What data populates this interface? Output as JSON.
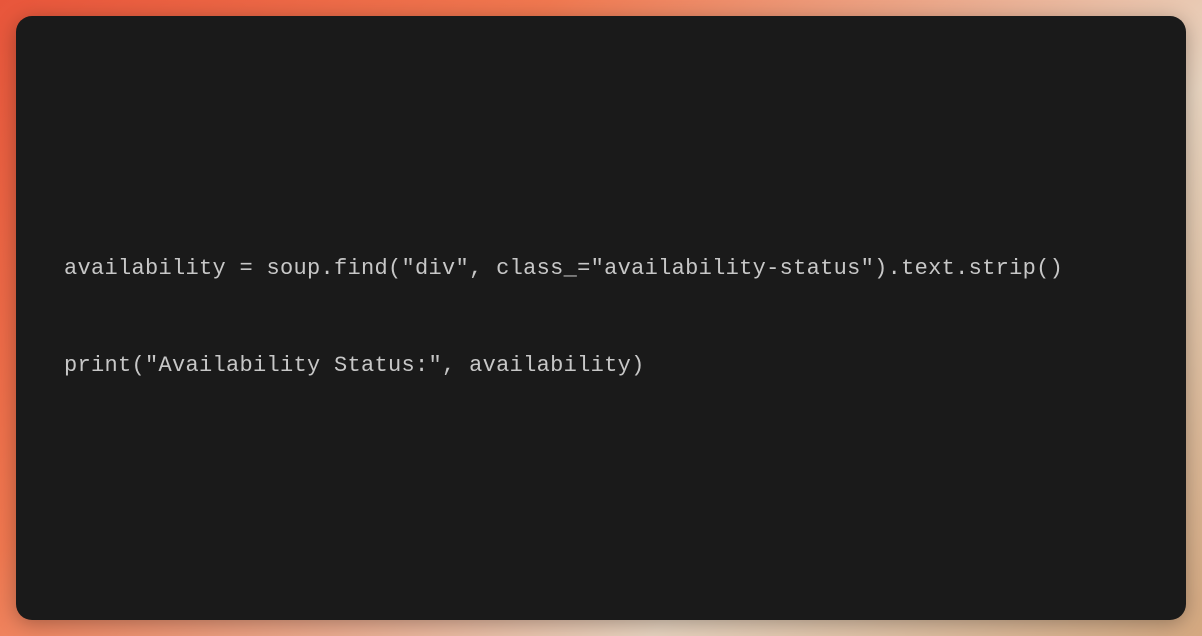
{
  "code": {
    "line1": "availability = soup.find(\"div\", class_=\"availability-status\").text.strip()",
    "line2": "",
    "line3": "print(\"Availability Status:\", availability)"
  }
}
